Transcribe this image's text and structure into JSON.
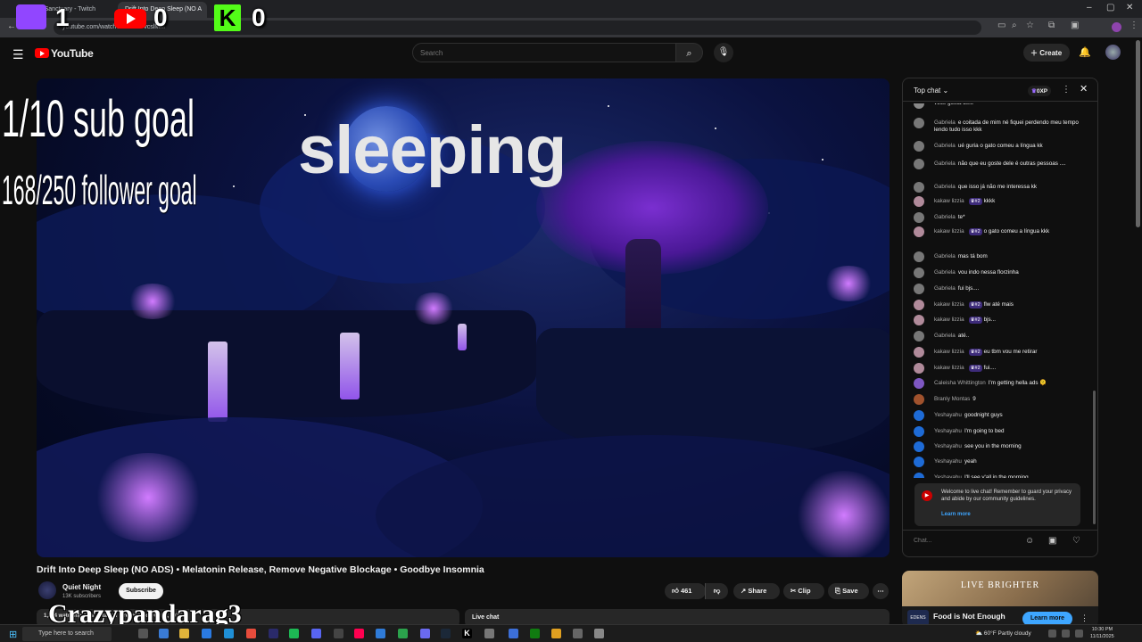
{
  "browser": {
    "tabs": [
      {
        "label": "veroSanctuary - Twitch"
      },
      {
        "label": "Drift Into Deep Sleep (NO A"
      }
    ],
    "url": "youtube.com/watch?v=PfcRFvcslMM"
  },
  "overlay": {
    "twitch_count": "1",
    "youtube_count": "0",
    "kick_count": "0",
    "sub_goal": "1/10 sub goal",
    "follower_goal": "168/250 follower goal",
    "watermark": "Crazypandarag3"
  },
  "header": {
    "logo": "YouTube",
    "search_placeholder": "Search",
    "create_label": "Create"
  },
  "video": {
    "overlay_text": "sleeping",
    "title": "Drift Into Deep Sleep (NO ADS) • Melatonin Release, Remove Negative Blockage • Goodbye Insomnia",
    "channel": "Quiet Night",
    "subscribers": "13K subscribers",
    "subscribe_label": "Subscribe",
    "likes": "461",
    "share_label": "Share",
    "clip_label": "Clip",
    "save_label": "Save",
    "desc_summary": "1,344 watching now · Started streaming on Oct 8, 2025",
    "live_chat_label": "Live chat"
  },
  "chat": {
    "mode": "Top chat",
    "xp": "0XP",
    "messages": [
      {
        "author": "",
        "text": "você gosta dele",
        "color": "#888888"
      },
      {
        "author": "Gabriela",
        "text": "e coitada de mim né fiquei perdendo meu tempo lendo tudo isso kkk",
        "color": "#777777"
      },
      {
        "author": "Gabriela",
        "text": "ué guria o gato comeu a língua kk",
        "color": "#777777"
      },
      {
        "author": "Gabriela",
        "text": "não que eu goste dele é outras pessoas ....",
        "color": "#777777"
      },
      {
        "author": "Gabriela",
        "text": "que isso já não me interessa kk",
        "color": "#777777"
      },
      {
        "author": "kakaw lizzia",
        "badge": "#2",
        "text": "kkkk",
        "color": "#b08a9a"
      },
      {
        "author": "Gabriela",
        "text": "te*",
        "color": "#777777"
      },
      {
        "author": "kakaw lizzia",
        "badge": "#2",
        "text": "o gato comeu a língua kkk",
        "color": "#b08a9a"
      },
      {
        "author": "Gabriela",
        "text": "mas tá bom",
        "color": "#777777"
      },
      {
        "author": "Gabriela",
        "text": "vou indo nessa florzinha",
        "color": "#777777"
      },
      {
        "author": "Gabriela",
        "text": "fui bjs....",
        "color": "#777777"
      },
      {
        "author": "kakaw lizzia",
        "badge": "#2",
        "text": "flw até mais",
        "color": "#b08a9a"
      },
      {
        "author": "kakaw lizzia",
        "badge": "#2",
        "text": "bjs...",
        "color": "#b08a9a"
      },
      {
        "author": "Gabriela",
        "text": "até..",
        "color": "#777777"
      },
      {
        "author": "kakaw lizzia",
        "badge": "#2",
        "text": "eu tbm vou me retirar",
        "color": "#b08a9a"
      },
      {
        "author": "kakaw lizzia",
        "badge": "#2",
        "text": "fui....",
        "color": "#b08a9a"
      },
      {
        "author": "Caleisha Whittington",
        "text": "I'm getting hella ads 🫠",
        "color": "#7e57c2"
      },
      {
        "author": "Branly Montas",
        "text": "9",
        "color": "#a0522d"
      },
      {
        "author": "Yeshayahu",
        "text": "goodnight guys",
        "color": "#1e6bd6"
      },
      {
        "author": "Yeshayahu",
        "text": "I'm going to bed",
        "color": "#1e6bd6"
      },
      {
        "author": "Yeshayahu",
        "text": "see you in the morning",
        "color": "#1e6bd6"
      },
      {
        "author": "Yeshayahu",
        "text": "yeah",
        "color": "#1e6bd6"
      },
      {
        "author": "Yeshayahu",
        "text": "I'll see y'all in the morning",
        "color": "#1e6bd6"
      }
    ],
    "welcome_text": "Welcome to live chat! Remember to guard your privacy and abide by our community guidelines.",
    "learn_more": "Learn more",
    "input_placeholder": "Chat..."
  },
  "promo": {
    "banner": "LIVE BRIGHTER",
    "logo_text": "EDENS",
    "title": "Food is Not Enough",
    "button": "Learn more"
  },
  "taskbar": {
    "search_placeholder": "Type here to search",
    "weather": "60°F  Partly cloudy",
    "time": "10:30 PM",
    "date": "11/11/2025"
  }
}
